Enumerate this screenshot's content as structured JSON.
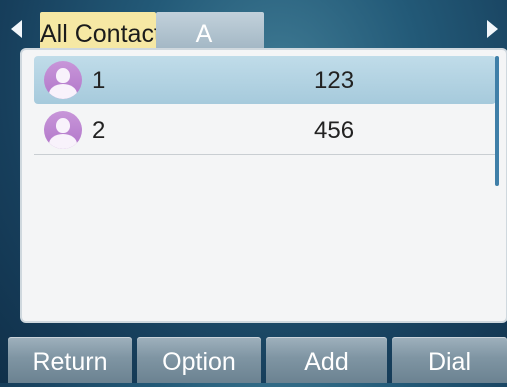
{
  "tabs": [
    {
      "label": "All Contacts",
      "selected": true
    },
    {
      "label": "A",
      "selected": false
    }
  ],
  "contacts": [
    {
      "name": "1",
      "number": "123",
      "selected": true
    },
    {
      "name": "2",
      "number": "456",
      "selected": false
    }
  ],
  "softkeys": [
    "Return",
    "Option",
    "Add",
    "Dial"
  ],
  "icons": {
    "left": "arrow-left-icon",
    "right": "arrow-right-icon",
    "avatar": "avatar-icon"
  },
  "colors": {
    "selected_tab": "#f6e8a4",
    "selected_row": "#b6d5e4",
    "avatar": "#c38bd5",
    "softkey": "#8aa0ae"
  }
}
